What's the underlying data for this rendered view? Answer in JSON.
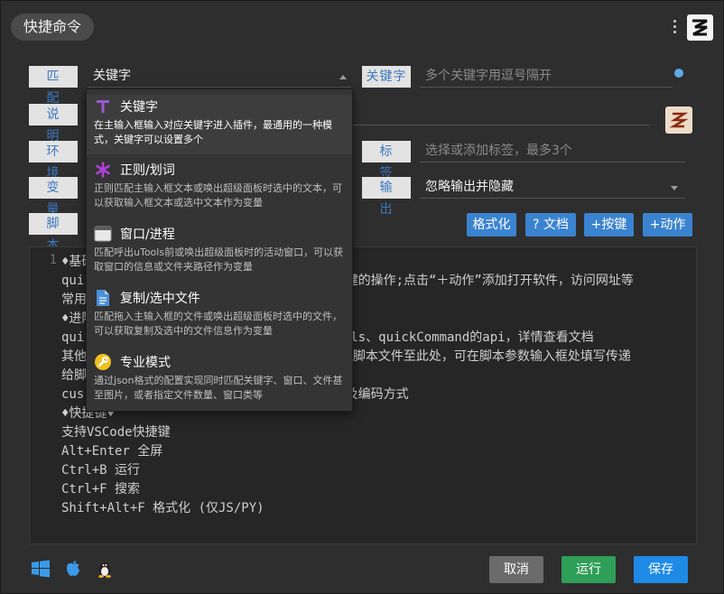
{
  "window": {
    "title": "快捷命令"
  },
  "form": {
    "match": {
      "label": "匹 配",
      "value": "关键字"
    },
    "keyword": {
      "label": "关键字",
      "placeholder": "多个关键字用逗号隔开"
    },
    "desc": {
      "label": "说 明"
    },
    "env": {
      "label": "环 境"
    },
    "tags": {
      "label": "标 签",
      "placeholder": "选择或添加标签，最多3个"
    },
    "vars": {
      "label": "变 量"
    },
    "output": {
      "label": "输 出",
      "value": "忽略输出并隐藏"
    },
    "script": {
      "label": "脚 本"
    }
  },
  "toolbar": {
    "format": "格式化",
    "docs": "? 文档",
    "add_key": "+按键",
    "add_action": "+动作"
  },
  "dropdown": {
    "options": [
      {
        "name": "关键字",
        "desc": "在主输入框输入对应关键字进入插件，最通用的一种模式，关键字可以设置多个",
        "icon": "text-icon",
        "color": "#9b59d0"
      },
      {
        "name": "正则/划词",
        "desc": "正则匹配主输入框文本或唤出超级面板时选中的文本，可以获取输入框文本或选中文本作为变量",
        "icon": "asterisk-icon",
        "color": "#b040d8"
      },
      {
        "name": "窗口/进程",
        "desc": "匹配呼出uTools前或唤出超级面板时的活动窗口，可以获取窗口的信息或文件夹路径作为变量",
        "icon": "window-icon",
        "color": "#3d8ad8"
      },
      {
        "name": "复制/选中文件",
        "desc": "匹配拖入主输入框的文件或唤出超级面板时选中的文件，可以获取复制及选中的文件信息作为变量",
        "icon": "file-icon",
        "color": "#3d8ad8"
      },
      {
        "name": "专业模式",
        "desc": "通过json格式的配置实现同时匹配关键字、窗口、文件甚至图片，或者指定文件数量、窗口类等",
        "icon": "wrench-icon",
        "color": "#f0c020"
      }
    ]
  },
  "editor": {
    "line_number": "1",
    "lines": [
      "♦基础",
      "qui                               拟按键的操作;点击“＋动作”添加打开软件，访问网址等",
      "常用",
      "♦进阶",
      "qui                               uTools、quickCommand的api，详情查看文档",
      "其他                              接拖放脚本文件至此处，可在脚本参数输入框处填写传递",
      "给脚",
      "cus                               后缀及编码方式",
      "♦快捷键♦",
      "支持VSCode快捷键",
      "Alt+Enter 全屏",
      "Ctrl+B 运行",
      "Ctrl+F 搜索",
      "Shift+Alt+F 格式化 (仅JS/PY)"
    ]
  },
  "footer": {
    "cancel": "取消",
    "run": "运行",
    "save": "保存",
    "colors": {
      "cancel": "#6b6b6b",
      "run": "#2e9e58",
      "save": "#1e8ae6"
    }
  }
}
